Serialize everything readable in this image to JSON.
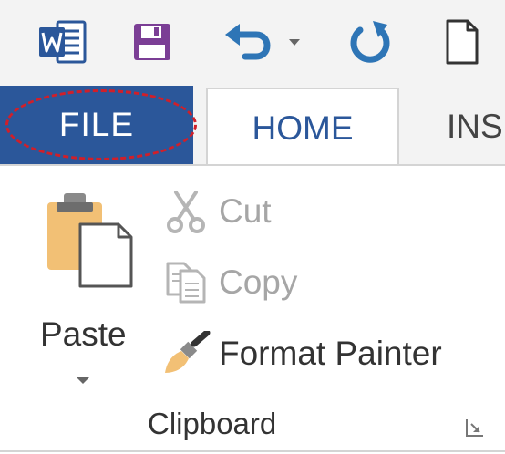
{
  "quick_access_toolbar": {
    "app_icon": "word-app-icon",
    "items": [
      "save-icon",
      "undo-icon",
      "dropdown-arrow-icon",
      "redo-icon",
      "new-document-icon"
    ]
  },
  "ribbon_tabs": {
    "file": "FILE",
    "home": "HOME",
    "insert_partial": "INS"
  },
  "clipboard_group": {
    "paste_label": "Paste",
    "cut_label": "Cut",
    "copy_label": "Copy",
    "format_painter_label": "Format Painter",
    "group_label": "Clipboard"
  },
  "colors": {
    "file_tab": "#2b579a",
    "home_text": "#2b579a",
    "highlight": "#d01f2a",
    "save_icon": "#7b3e95",
    "undo_redo": "#2e75b6",
    "disabled_text": "#a6a6a6"
  }
}
